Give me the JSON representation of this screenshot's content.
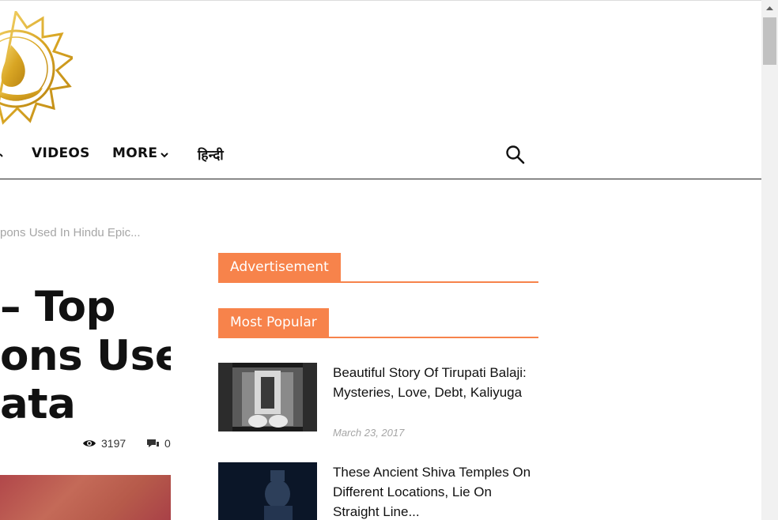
{
  "nav": {
    "items": [
      {
        "label": "VIDEOS"
      },
      {
        "label": "MORE"
      },
      {
        "label": "हिन्दी"
      }
    ]
  },
  "article": {
    "breadcrumb": "pons Used In Hindu Epic...",
    "title_lines": [
      "– Top",
      "ons Used",
      "ata"
    ],
    "views": "3197",
    "comments": "0"
  },
  "sidebar": {
    "advertisement_label": "Advertisement",
    "most_popular_label": "Most Popular",
    "posts": [
      {
        "title": "Beautiful Story Of Tirupati Balaji: Mysteries, Love, Debt, Kaliyuga",
        "date": "March 23, 2017"
      },
      {
        "title": "These Ancient Shiva Temples On Different Locations, Lie On Straight Line...",
        "date": ""
      }
    ]
  },
  "colors": {
    "accent": "#f7834b"
  }
}
